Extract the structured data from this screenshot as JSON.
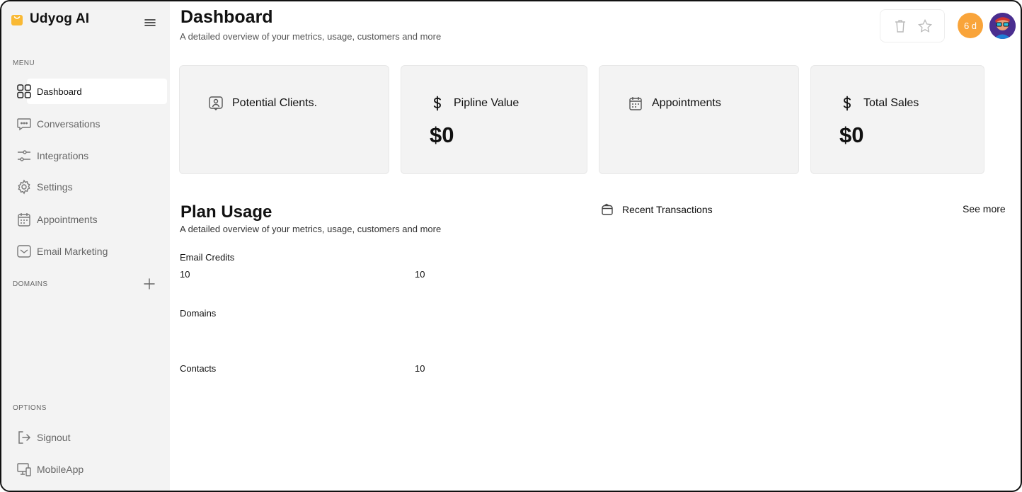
{
  "brand": {
    "name": "Udyog AI",
    "accent": "#f9b934"
  },
  "sidebar": {
    "menu_label": "MENU",
    "items": [
      {
        "label": "Dashboard",
        "icon": "grid-icon"
      },
      {
        "label": "Conversations",
        "icon": "chat-icon"
      },
      {
        "label": "Integrations",
        "icon": "sliders-icon"
      },
      {
        "label": "Settings",
        "icon": "gear-icon"
      },
      {
        "label": "Appointments",
        "icon": "calendar-icon"
      },
      {
        "label": "Email Marketing",
        "icon": "mail-icon"
      }
    ],
    "domains_label": "DOMAINS",
    "options_label": "OPTIONS",
    "options": [
      {
        "label": "Signout",
        "icon": "signout-icon"
      },
      {
        "label": "MobileApp",
        "icon": "device-icon"
      }
    ]
  },
  "header": {
    "title": "Dashboard",
    "subtitle": "A detailed overview of your metrics, usage, customers and more",
    "trial_badge": "6 d",
    "trial_color": "#f9a43a"
  },
  "cards": [
    {
      "label": "Potential Clients.",
      "value": "",
      "icon": "user-card-icon"
    },
    {
      "label": "Pipline Value",
      "value": "$0",
      "icon": "dollar-icon"
    },
    {
      "label": "Appointments",
      "value": "",
      "icon": "calendar-icon"
    },
    {
      "label": "Total Sales",
      "value": "$0",
      "icon": "dollar-icon"
    }
  ],
  "plan_usage": {
    "title": "Plan Usage",
    "subtitle": "A detailed overview of your metrics, usage, customers and more",
    "rows": [
      {
        "label": "Email Credits",
        "used": "10",
        "limit": "10"
      },
      {
        "label": "Domains",
        "used": "",
        "limit": ""
      },
      {
        "label": "Contacts",
        "used": "",
        "limit": "10"
      }
    ]
  },
  "transactions": {
    "title": "Recent Transactions",
    "see_more": "See more"
  }
}
